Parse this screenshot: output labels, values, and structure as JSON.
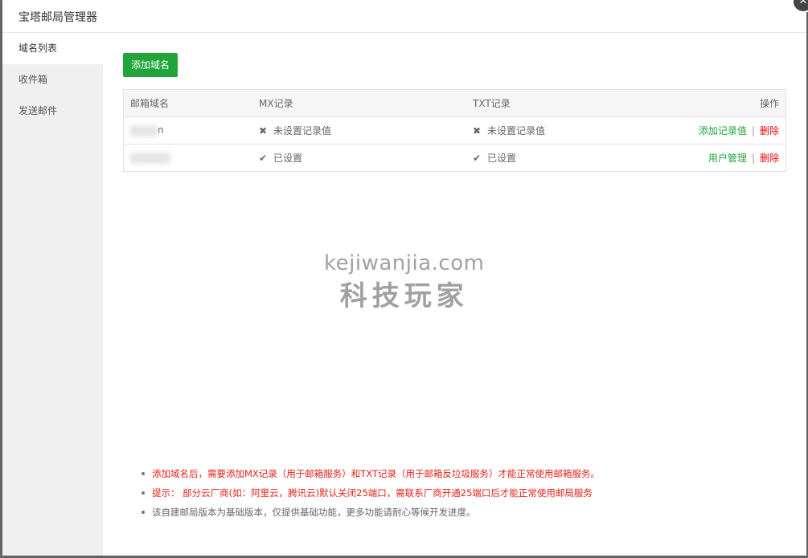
{
  "modal": {
    "title": "宝塔邮局管理器",
    "close_symbol": "✕"
  },
  "sidebar": {
    "items": [
      {
        "label": "域名列表",
        "active": true
      },
      {
        "label": "收件箱",
        "active": false
      },
      {
        "label": "发送邮件",
        "active": false
      }
    ]
  },
  "toolbar": {
    "add_domain_label": "添加域名"
  },
  "table": {
    "headers": [
      "邮箱域名",
      "MX记录",
      "TXT记录",
      "操作"
    ],
    "rows": [
      {
        "domain_suffix": "n",
        "mx_status": "未设置记录值",
        "txt_status": "未设置记录值",
        "action_primary": "添加记录值",
        "action_delete": "删除"
      },
      {
        "domain_suffix": "",
        "mx_status": "已设置",
        "txt_status": "已设置",
        "action_primary": "用户管理",
        "action_delete": "删除"
      }
    ],
    "separator": "|",
    "bad_symbol": "✖",
    "good_symbol": "✔"
  },
  "watermark": {
    "line1": "kejiwanjia.com",
    "line2": "科技玩家"
  },
  "tips": [
    "添加域名后，需要添加MX记录（用于邮箱服务）和TXT记录（用于邮箱反垃圾服务）才能正常使用邮箱服务。",
    "提示： 部分云厂商(如：阿里云，腾讯云)默认关闭25端口，需联系厂商开通25端口后才能正常使用邮局服务",
    "该自建邮局版本为基础版本，仅提供基础功能，更多功能请耐心等候开发进度。"
  ],
  "colors": {
    "accent_green": "#20a53a",
    "danger_red": "#ef0808"
  }
}
